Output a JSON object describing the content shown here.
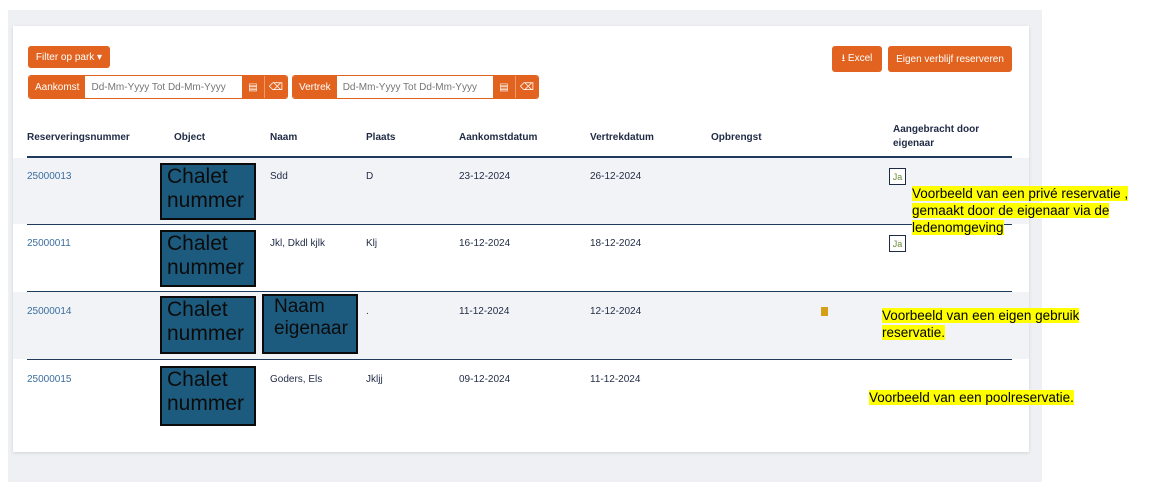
{
  "filters": {
    "park_filter_label": "Filter op park ▾",
    "arrival": {
      "label": "Aankomst",
      "placeholder": "Dd-Mm-Yyyy Tot Dd-Mm-Yyyy"
    },
    "departure": {
      "label": "Vertrek",
      "placeholder": "Dd-Mm-Yyyy Tot Dd-Mm-Yyyy"
    }
  },
  "actions": {
    "excel_label": "⭳ Excel",
    "reserve_label": "Eigen verblijf reserveren"
  },
  "table": {
    "headers": {
      "reservation_number": "Reserveringsnummer",
      "object": "Object",
      "name": "Naam",
      "place": "Plaats",
      "arrival_date": "Aankomstdatum",
      "departure_date": "Vertrekdatum",
      "revenue": "Opbrengst",
      "by_owner_1": "Aangebracht door",
      "by_owner_2": "eigenaar"
    },
    "rows": [
      {
        "number": "25000013",
        "object_1": "Chalet",
        "object_2": "nummer",
        "name": "Sdd",
        "place": "D",
        "arrival": "23-12-2024",
        "departure": "26-12-2024",
        "by_owner": "Ja"
      },
      {
        "number": "25000011",
        "object_1": "Chalet",
        "object_2": "nummer",
        "name": "Jkl, Dkdl kjlk",
        "place": "Klj",
        "arrival": "16-12-2024",
        "departure": "18-12-2024",
        "by_owner": "Ja"
      },
      {
        "number": "25000014",
        "object_1": "Chalet",
        "object_2": "nummer",
        "name_1": "Naam",
        "name_2": "eigenaar",
        "place": ".",
        "arrival": "11-12-2024",
        "departure": "12-12-2024"
      },
      {
        "number": "25000015",
        "object_1": "Chalet",
        "object_2": "nummer",
        "name": "Goders, Els",
        "place": "Jkljj",
        "arrival": "09-12-2024",
        "departure": "11-12-2024"
      }
    ]
  },
  "annotations": {
    "private_1": "Voorbeeld van een privé reservatie ,",
    "private_2": "gemaakt door de eigenaar via de",
    "private_3": "ledenomgeving",
    "own_use_1": "Voorbeeld van een eigen gebruik",
    "own_use_2": "reservatie.",
    "pool": "Voorbeeld van een poolreservatie."
  },
  "colors": {
    "accent": "#e2631f",
    "link": "#3b6ea0",
    "overlay": "#1d5b7e",
    "highlight": "#ffff00"
  }
}
